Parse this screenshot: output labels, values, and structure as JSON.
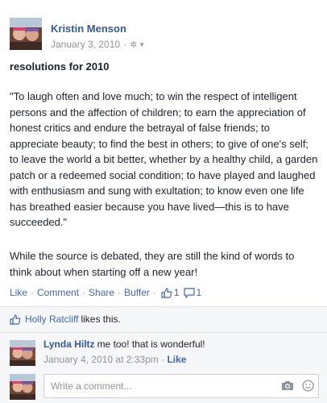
{
  "post": {
    "author": "Kristin Menson",
    "date": "January 3, 2010",
    "title": "resolutions for 2010",
    "quote": "\"To laugh often and love much; to win the respect of intelligent persons and the affection of children; to earn the appreciation of honest critics and endure the betrayal of false friends; to appreciate beauty; to find the best in others; to give of one's self; to leave the world a bit better, whether by a healthy child, a garden patch or a redeemed social condition; to have played and laughed with enthusiasm and sung with exultation; to know even one life has breathed easier because you have lived—this is to have succeeded.\"",
    "body": "While the source is debated, they are still the kind of words to think about when starting off a new year!",
    "privacy_icon": "gear-icon"
  },
  "actions": {
    "like": "Like",
    "comment": "Comment",
    "share": "Share",
    "buffer": "Buffer",
    "like_count": "1",
    "comment_count": "1"
  },
  "likes": {
    "liker": "Holly Ratcliff",
    "text": "likes this."
  },
  "comments": [
    {
      "author": "Lynda Hiltz",
      "text": "me too! that is wonderful!",
      "date": "January 4, 2010 at 2:33pm",
      "like_label": "Like"
    }
  ],
  "composer": {
    "placeholder": "Write a comment..."
  },
  "colors": {
    "link": "#365899",
    "action": "#4267b2",
    "meta": "#90949c"
  }
}
